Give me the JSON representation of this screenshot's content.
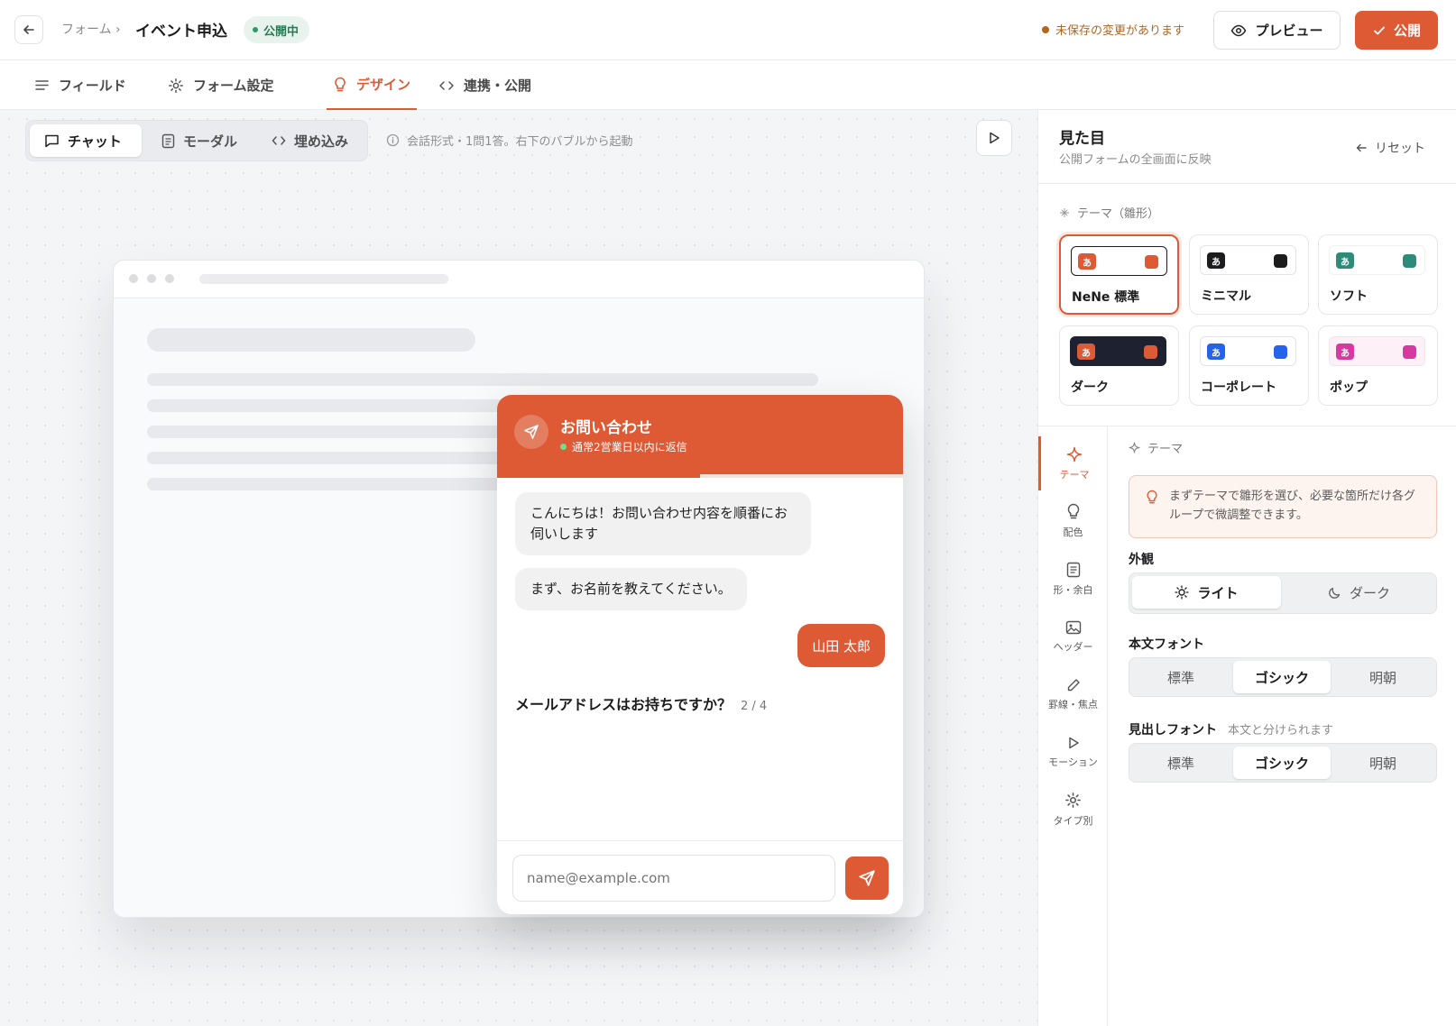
{
  "header": {
    "breadcrumb": "フォーム ›",
    "form_title": "イベント申込",
    "status": "公開中",
    "unsaved": "未保存の変更があります",
    "preview_label": "プレビュー",
    "publish_label": "公開"
  },
  "tabs": [
    {
      "label": "フィールド",
      "icon": "list-icon"
    },
    {
      "label": "フォーム設定",
      "icon": "gear-icon"
    },
    {
      "label": "デザイン",
      "icon": "bulb-icon",
      "active": true
    },
    {
      "label": "連携・公開",
      "icon": "code-icon"
    }
  ],
  "canvas": {
    "modes": [
      {
        "label": "チャット",
        "icon": "chat-icon",
        "active": true
      },
      {
        "label": "モーダル",
        "icon": "document-icon"
      },
      {
        "label": "埋め込み",
        "icon": "code-icon"
      }
    ],
    "hint": "会話形式・1問1答。右下のバブルから起動"
  },
  "chat": {
    "title": "お問い合わせ",
    "subtitle": "通常2営業日以内に返信",
    "progress": 0.5,
    "messages": [
      {
        "from": "bot",
        "text": "こんにちは！お問い合わせ内容を順番にお伺いします"
      },
      {
        "from": "bot",
        "text": "まず、お名前を教えてください。"
      },
      {
        "from": "user",
        "text": "山田 太郎"
      }
    ],
    "question": "メールアドレスはお持ちですか？",
    "step": "2 / 4",
    "input_placeholder": "name@example.com"
  },
  "panel": {
    "title": "見た目",
    "subtitle": "公開フォームの全画面に反映",
    "reset_label": "リセット",
    "theme_section": "テーマ（雛形）",
    "themes": [
      {
        "name": "NeNe 標準",
        "glyph": "あ",
        "accent": "#dd5a34",
        "bg": "#ffffff",
        "selected": true
      },
      {
        "name": "ミニマル",
        "glyph": "あ",
        "accent": "#1c1c1e",
        "bg": "#ffffff"
      },
      {
        "name": "ソフト",
        "glyph": "あ",
        "accent": "#2e8b7a",
        "bg": "#ffffff"
      },
      {
        "name": "ダーク",
        "glyph": "あ",
        "accent": "#dd5a34",
        "bg": "#1e2230"
      },
      {
        "name": "コーポレート",
        "glyph": "あ",
        "accent": "#2563eb",
        "bg": "#ffffff"
      },
      {
        "name": "ポップ",
        "glyph": "あ",
        "accent": "#d63aa0",
        "bg": "#fdf0f7"
      }
    ],
    "nav": [
      {
        "label": "テーマ",
        "icon": "sparkle-icon",
        "active": true
      },
      {
        "label": "配色",
        "icon": "bulb-icon"
      },
      {
        "label": "形・余白",
        "icon": "document-icon"
      },
      {
        "label": "ヘッダー",
        "icon": "image-icon"
      },
      {
        "label": "罫線・焦点",
        "icon": "pencil-icon"
      },
      {
        "label": "モーション",
        "icon": "play-icon"
      },
      {
        "label": "タイプ別",
        "icon": "gear-icon"
      }
    ],
    "pane_title": "テーマ",
    "tip": "まずテーマで雛形を選び、必要な箇所だけ各グループで微調整できます。",
    "appearance_label": "外観",
    "appearance_options": [
      {
        "label": "ライト",
        "icon": "sun-icon",
        "active": true
      },
      {
        "label": "ダーク",
        "icon": "moon-icon"
      }
    ],
    "body_font_label": "本文フォント",
    "body_font_options": [
      "標準",
      "ゴシック",
      "明朝"
    ],
    "body_font_selected": 1,
    "heading_font_label": "見出しフォント",
    "heading_font_hint": "本文と分けられます",
    "heading_font_options": [
      "標準",
      "ゴシック",
      "明朝"
    ],
    "heading_font_selected": 1
  },
  "colors": {
    "accent": "#dd5a34",
    "status_green": "#2c9a63"
  }
}
